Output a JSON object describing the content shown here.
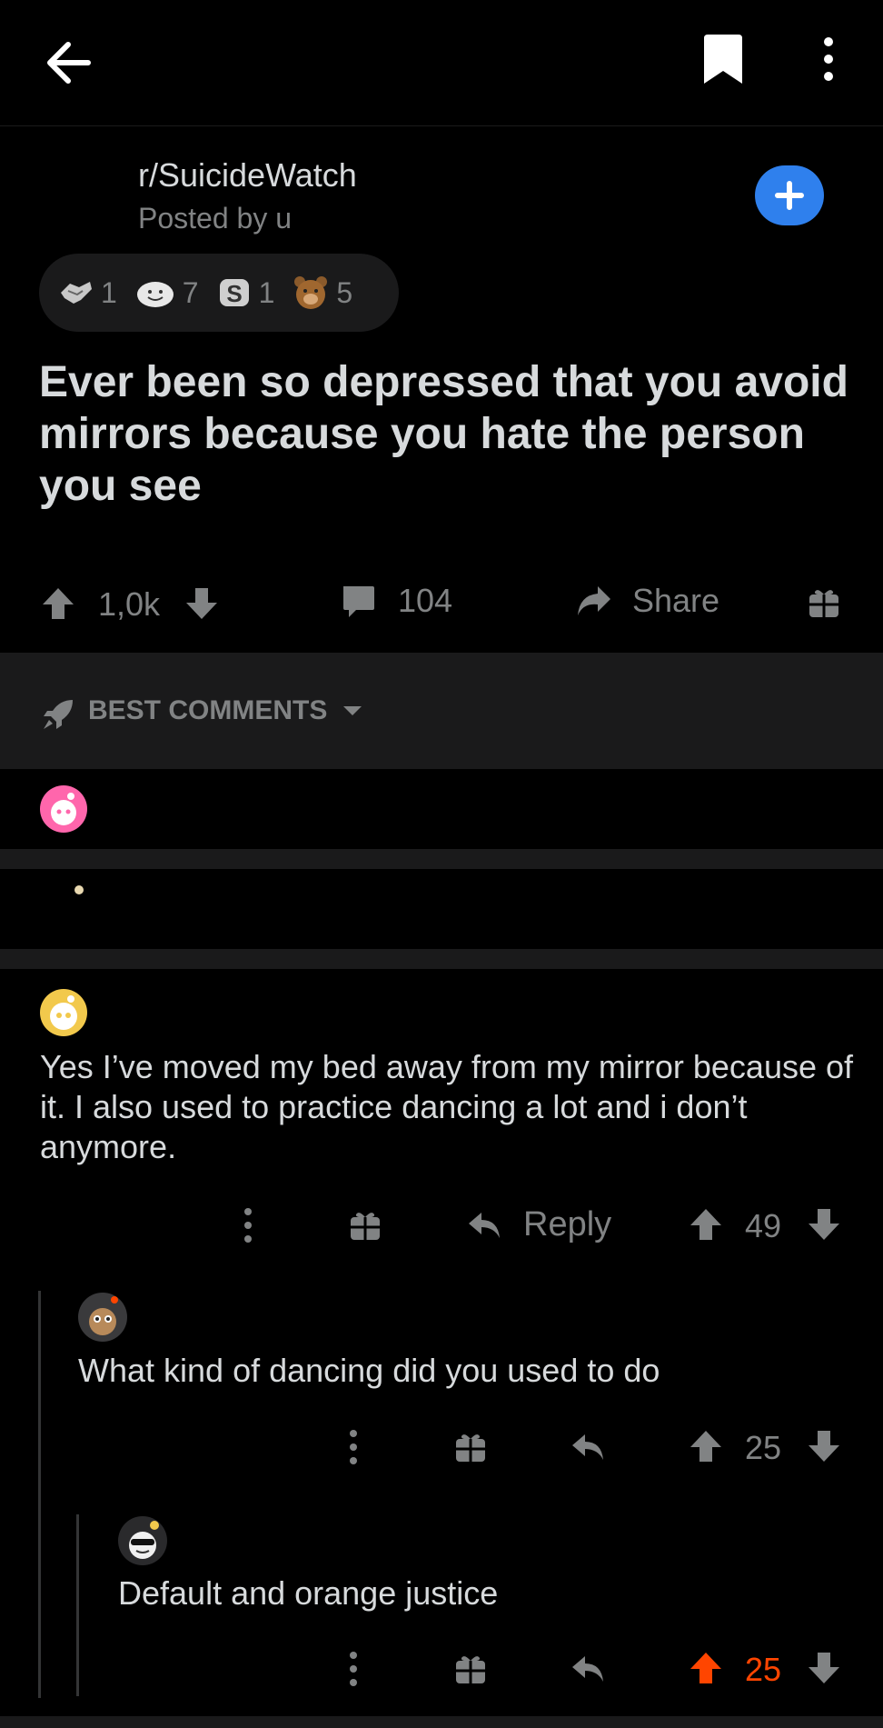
{
  "topbar": {
    "back_icon": "arrow-left-icon",
    "bookmark_icon": "bookmark-icon",
    "more_icon": "vertical-dots-icon"
  },
  "post": {
    "subreddit": "r/SuicideWatch",
    "posted_by": "Posted by u",
    "awards": [
      {
        "icon": "handshake-award-icon",
        "count": "1"
      },
      {
        "icon": "wholesome-award-icon",
        "count": "7"
      },
      {
        "icon": "silver-award-icon",
        "count": "1"
      },
      {
        "icon": "bear-award-icon",
        "count": "5"
      }
    ],
    "title": "Ever been so depressed that you avoid mirrors because you hate the person you see",
    "upvotes": "1,0k",
    "comments": "104",
    "share_label": "Share"
  },
  "sort": {
    "label": "BEST COMMENTS"
  },
  "comments": [
    {
      "text": "Yes I’ve moved my bed away from my mirror because of it. I also used to practice dancing a lot and i don’t anymore.",
      "reply_label": "Reply",
      "votes": "49"
    },
    {
      "text": "What kind of dancing did you used to do",
      "votes": "25"
    },
    {
      "text": "Default and orange justice",
      "votes": "25"
    }
  ],
  "colors": {
    "background": "#000000",
    "accent_blue": "#2f80ed",
    "upvote_orange": "#ff4500",
    "muted": "#818384"
  }
}
